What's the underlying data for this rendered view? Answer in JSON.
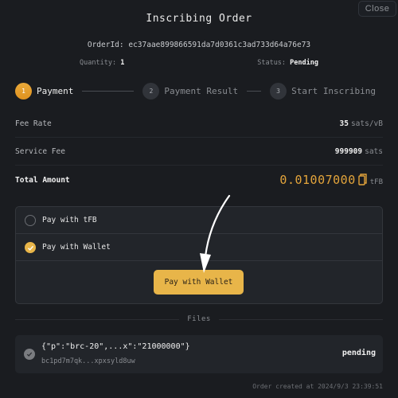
{
  "header": {
    "title": "Inscribing Order",
    "close_label": "Close",
    "order_id_label": "OrderId:",
    "order_id": "ec37aae899866591da7d0361c3ad733d64a76e73",
    "quantity_label": "Quantity:",
    "quantity": "1",
    "status_label": "Status:",
    "status": "Pending"
  },
  "steps": [
    {
      "number": "1",
      "label": "Payment",
      "state": "active"
    },
    {
      "number": "2",
      "label": "Payment Result",
      "state": "inactive"
    },
    {
      "number": "3",
      "label": "Start Inscribing",
      "state": "inactive"
    }
  ],
  "fees": {
    "fee_rate_label": "Fee Rate",
    "fee_rate_value": "35",
    "fee_rate_unit": "sats/vB",
    "service_fee_label": "Service Fee",
    "service_fee_value": "999909",
    "service_fee_unit": "sats",
    "total_label": "Total Amount",
    "total_value": "0.01007000",
    "total_unit": "tFB",
    "copy_icon": "copy-icon"
  },
  "payment": {
    "options": [
      {
        "label": "Pay with tFB",
        "selected": false
      },
      {
        "label": "Pay with Wallet",
        "selected": true
      }
    ],
    "button_label": "Pay with Wallet"
  },
  "files": {
    "header": "Files",
    "items": [
      {
        "name": "{\"p\":\"brc-20\",...x\":\"21000000\"}",
        "address": "bc1pd7m7qk...xpxsyld8uw",
        "status": "pending"
      }
    ]
  },
  "footer": {
    "created": "Order created at 2024/9/3 23:39:51"
  },
  "colors": {
    "accent": "#e8b549",
    "total_amount": "#e3a43b",
    "background": "#1a1c20",
    "panel": "#22252a"
  }
}
